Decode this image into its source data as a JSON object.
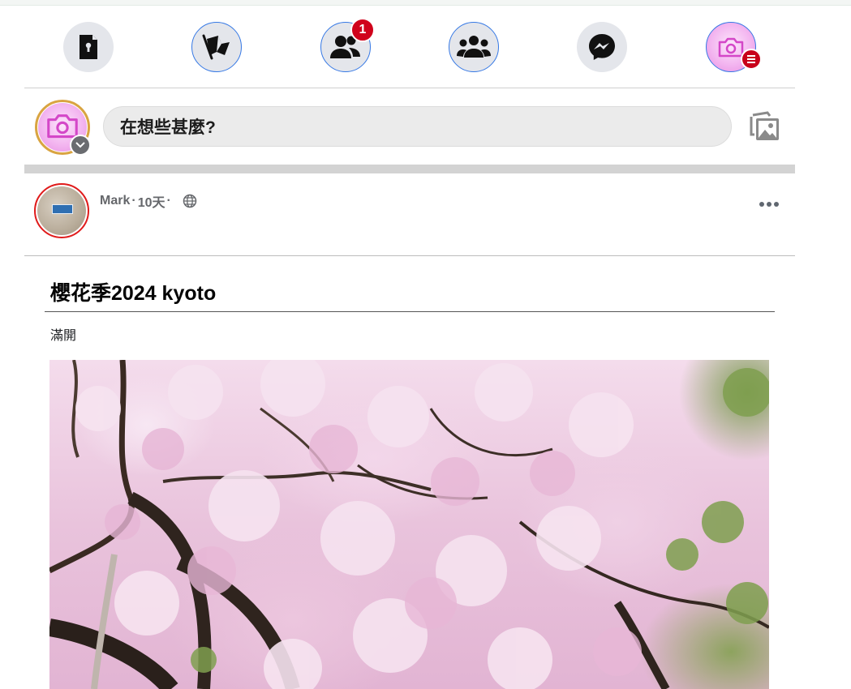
{
  "nav": {
    "items": [
      {
        "name": "pages",
        "icon": "door-document-icon"
      },
      {
        "name": "flags",
        "icon": "flag-icon"
      },
      {
        "name": "friends",
        "icon": "friends-icon",
        "badge": "1"
      },
      {
        "name": "groups",
        "icon": "groups-icon"
      },
      {
        "name": "messenger",
        "icon": "messenger-icon"
      },
      {
        "name": "profile",
        "icon": "camera-icon",
        "menu_badge": true
      }
    ]
  },
  "composer": {
    "placeholder": "在想些甚麼?",
    "photo_icon": "photo-gallery-icon"
  },
  "post": {
    "author": "Mark",
    "time": "10天",
    "privacy_icon": "globe-icon",
    "more_icon": "more-dots-icon",
    "title": "櫻花季2024 kyoto",
    "text": "滿開"
  },
  "colors": {
    "accent_blue": "#3578e5",
    "badge_red": "#d0021b",
    "nav_gray": "#e4e6eb"
  }
}
